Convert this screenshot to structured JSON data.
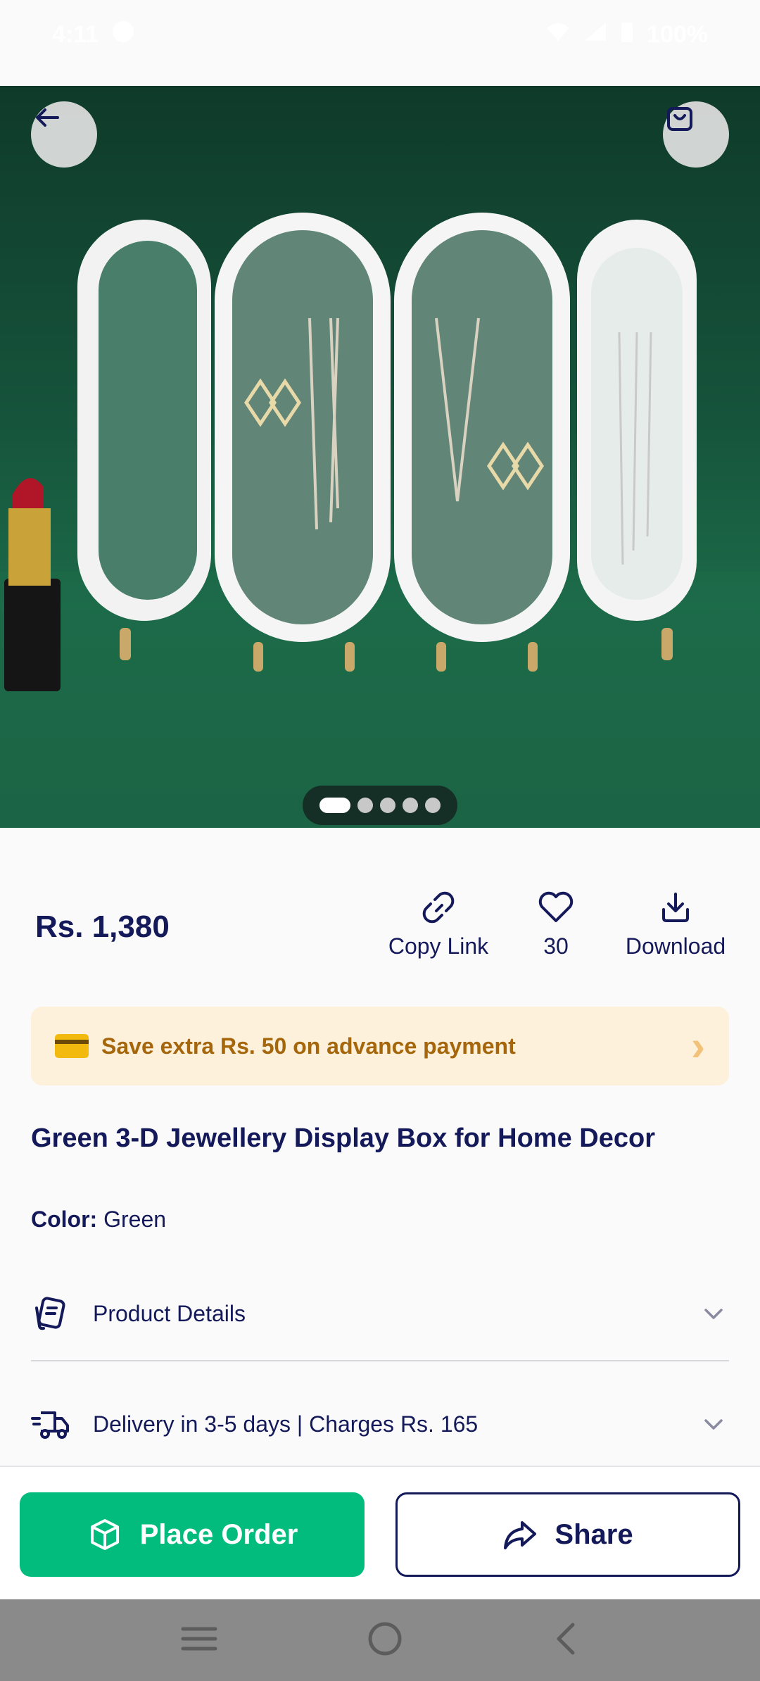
{
  "status_bar": {
    "time": "4:11",
    "battery": "100%"
  },
  "hero": {
    "image_description": "jewellery-display-box-photo",
    "carousel_count": 5,
    "carousel_active": 0
  },
  "price": "Rs. 1,380",
  "actions": {
    "copy_link": "Copy Link",
    "likes_count": "30",
    "download": "Download"
  },
  "banner": {
    "text": "Save extra Rs. 50 on advance payment"
  },
  "product": {
    "title": "Green 3-D Jewellery Display Box for Home Decor",
    "color_label": "Color:",
    "color_value": "Green"
  },
  "accordions": {
    "details_label": "Product Details",
    "delivery_label": "Delivery in 3-5 days | Charges Rs. 165"
  },
  "bottom": {
    "place_order": "Place Order",
    "share": "Share"
  },
  "colors": {
    "primary_text": "#14195a",
    "accent_green": "#02bc7d",
    "banner_bg": "#fef1dc",
    "banner_text": "#a5660c"
  }
}
